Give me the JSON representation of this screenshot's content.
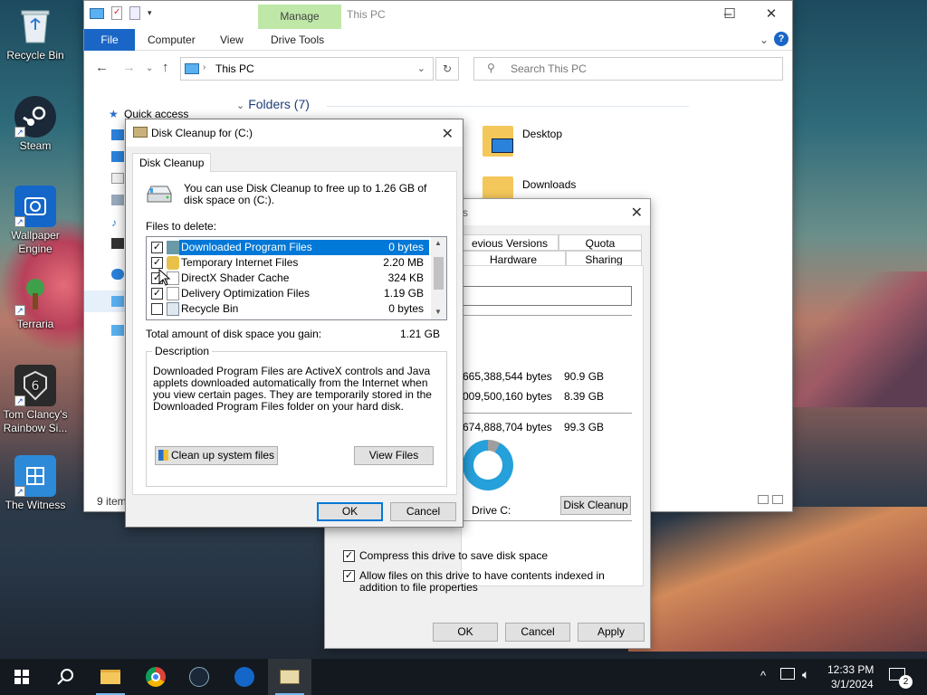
{
  "desktop": {
    "icons": [
      {
        "label": "Recycle Bin"
      },
      {
        "label": "Steam"
      },
      {
        "label": "Wallpaper Engine"
      },
      {
        "label": "Terraria"
      },
      {
        "label": "Tom Clancy's Rainbow Si..."
      },
      {
        "label": "The Witness"
      }
    ]
  },
  "explorer": {
    "title": "This PC",
    "manage_tab": "Manage",
    "tabs": [
      "File",
      "Computer",
      "View",
      "Drive Tools"
    ],
    "address": "This PC",
    "search_placeholder": "Search This PC",
    "quick_access": "Quick access",
    "folders_header": "Folders (7)",
    "folders": [
      "Desktop",
      "Downloads"
    ],
    "status": "9 item"
  },
  "props": {
    "title_fragment": "s",
    "tabs_row1": [
      "evious Versions",
      "Quota"
    ],
    "tabs_row2": [
      "Hardware",
      "Sharing"
    ],
    "rows": [
      {
        "bytes": "665,388,544 bytes",
        "size": "90.9 GB"
      },
      {
        "bytes": "009,500,160 bytes",
        "size": "8.39 GB"
      },
      {
        "bytes": "674,888,704 bytes",
        "size": "99.3 GB"
      }
    ],
    "drive_label": "Drive C:",
    "disk_cleanup_button": "Disk Cleanup",
    "compress_label": "Compress this drive to save disk space",
    "index_label": "Allow files on this drive to have contents indexed in addition to file properties",
    "ok": "OK",
    "cancel": "Cancel",
    "apply": "Apply"
  },
  "cleanup": {
    "title": "Disk Cleanup for  (C:)",
    "tab": "Disk Cleanup",
    "intro": "You can use Disk Cleanup to free up to 1.26 GB of disk space on  (C:).",
    "files_label": "Files to delete:",
    "files": [
      {
        "name": "Downloaded Program Files",
        "size": "0 bytes",
        "checked": "✓"
      },
      {
        "name": "Temporary Internet Files",
        "size": "2.20 MB",
        "checked": "✓"
      },
      {
        "name": "DirectX Shader Cache",
        "size": "324 KB",
        "checked": "✓"
      },
      {
        "name": "Delivery Optimization Files",
        "size": "1.19 GB",
        "checked": "✓"
      },
      {
        "name": "Recycle Bin",
        "size": "0 bytes",
        "checked": ""
      }
    ],
    "total_label": "Total amount of disk space you gain:",
    "total_value": "1.21 GB",
    "description_label": "Description",
    "description": "Downloaded Program Files are ActiveX controls and Java applets downloaded automatically from the Internet when you view certain pages. They are temporarily stored in the Downloaded Program Files folder on your hard disk.",
    "cleanup_system_button": "Clean up system files",
    "view_files_button": "View Files",
    "ok": "OK",
    "cancel": "Cancel"
  },
  "taskbar": {
    "time": "12:33 PM",
    "date": "3/1/2024",
    "notification_count": "2"
  },
  "colors": {
    "accent": "#0078d7",
    "file_tab": "#1a66c7",
    "manage": "#bfe8a8"
  }
}
